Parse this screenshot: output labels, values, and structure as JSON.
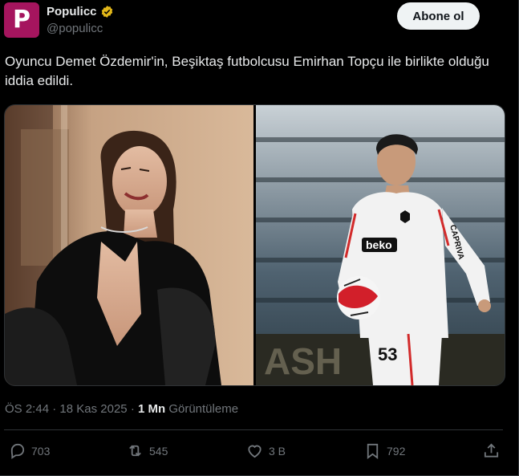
{
  "account": {
    "display_name": "Populicc",
    "handle": "@populicc",
    "avatar_letter": "P",
    "avatar_color": "#a5155e",
    "verified_color": "#e2b719"
  },
  "follow_label": "Abone ol",
  "tweet": {
    "text": "Oyuncu Demet Özdemir'in, Beşiktaş futbolcusu Emirhan Topçu ile birlikte olduğu iddia edildi."
  },
  "media": {
    "right_image": {
      "jersey_sponsor": "beko",
      "sleeve_text": "CAPRIVA",
      "shirt_number": "53",
      "board_text": "ASH"
    }
  },
  "meta": {
    "time": "ÖS 2:44",
    "separator": "·",
    "date": "18 Kas 2025",
    "views_count": "1 Mn",
    "views_label": "Görüntüleme"
  },
  "actions": {
    "replies": "703",
    "reposts": "545",
    "likes": "3 B",
    "bookmarks": "792"
  },
  "colors": {
    "background": "#000000",
    "text": "#e7e9ea",
    "muted": "#71767b",
    "border": "#2f3336"
  }
}
